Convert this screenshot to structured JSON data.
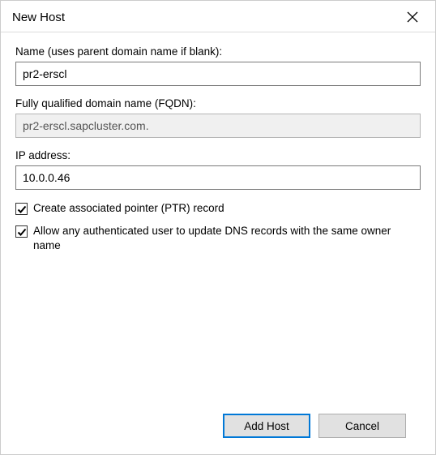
{
  "title": "New Host",
  "fields": {
    "name": {
      "label": "Name (uses parent domain name if blank):",
      "value": "pr2-erscl"
    },
    "fqdn": {
      "label": "Fully qualified domain name (FQDN):",
      "value": "pr2-erscl.sapcluster.com."
    },
    "ip": {
      "label": "IP address:",
      "value": "10.0.0.46"
    }
  },
  "checkboxes": {
    "ptr": {
      "label": "Create associated pointer (PTR) record",
      "checked": true
    },
    "allow_update": {
      "label": "Allow any authenticated user to update DNS records with the same owner name",
      "checked": true
    }
  },
  "buttons": {
    "add_host": "Add Host",
    "cancel": "Cancel"
  }
}
